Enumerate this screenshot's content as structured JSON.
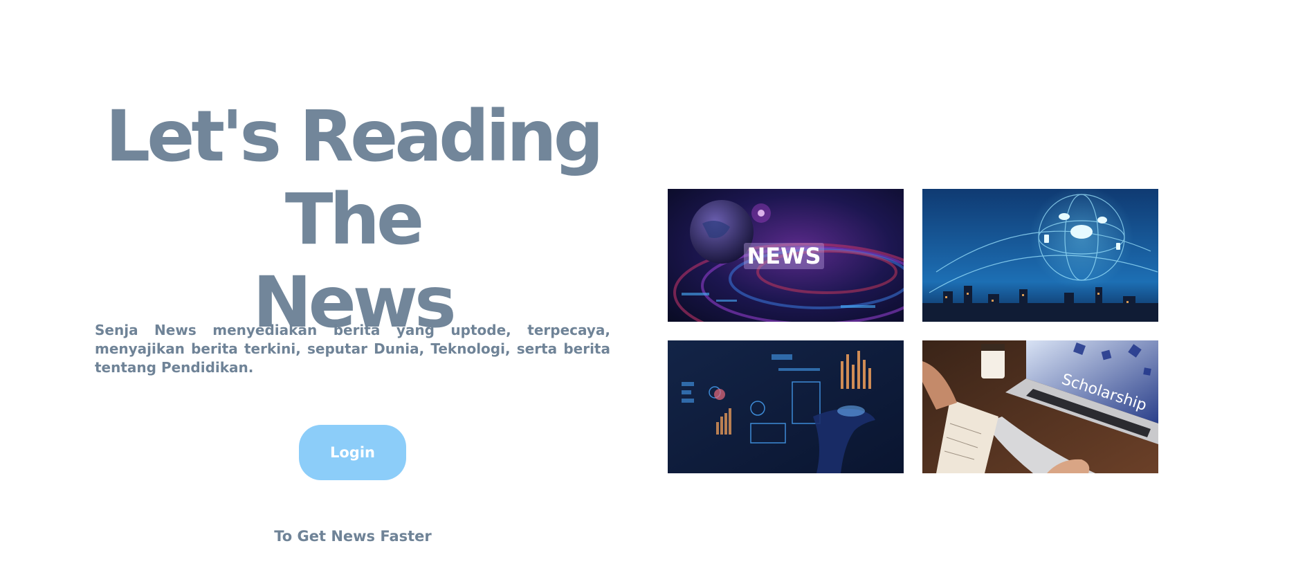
{
  "hero": {
    "title_line1": "Let's Reading The",
    "title_line2": "News",
    "description": "Senja News menyediakan berita yang uptode, terpecaya, menyajikan berita terkini, seputar Dunia, Teknologi, serta berita tentang Pendidikan.",
    "login_label": "Login",
    "tagline": "To Get News Faster"
  },
  "gallery": {
    "news_badge": "NEWS",
    "scholarship_screen": "Scholarship"
  },
  "colors": {
    "text": "#72869a",
    "button": "#8ccdf9",
    "button_text": "#ffffff",
    "background": "#ffffff"
  }
}
